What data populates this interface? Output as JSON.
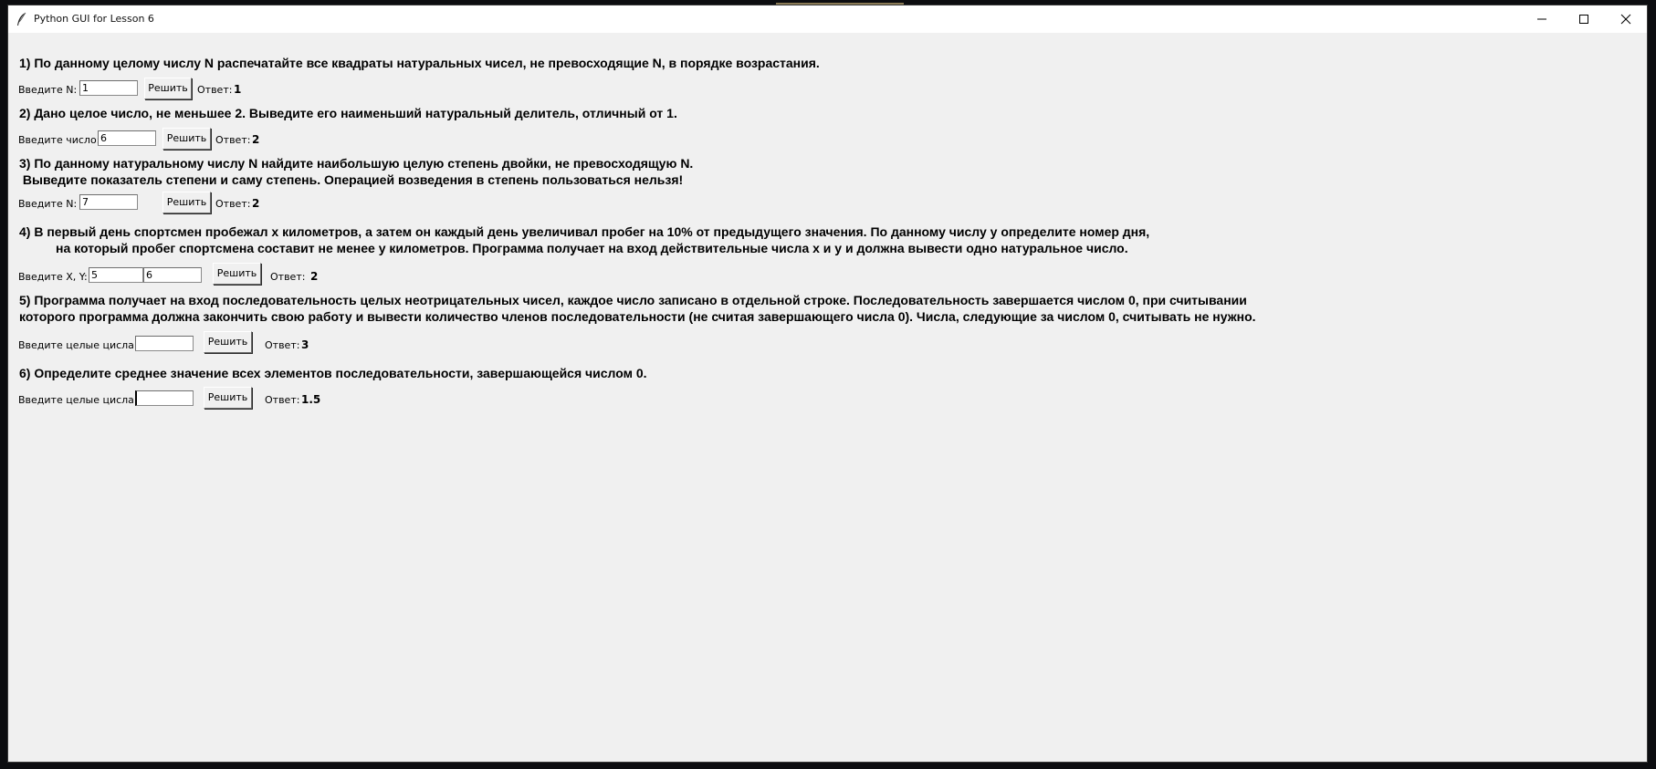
{
  "window": {
    "title": "Python GUI for Lesson 6",
    "minimize_icon": "minimize-icon",
    "maximize_icon": "maximize-icon",
    "close_icon": "close-icon",
    "app_icon": "tk-feather-icon"
  },
  "tasks": [
    {
      "heading_lines": [
        "1) По данному целому числу N распечатайте все квадраты натуральных чисел, не превосходящие N, в порядке возрастания."
      ],
      "input_label": "Введите N:",
      "inputs": [
        "1"
      ],
      "button": "Решить",
      "answer_label": "Ответ:",
      "answer": "1"
    },
    {
      "heading_lines": [
        "2) Дано целое число, не меньшее 2. Выведите его наименьший натуральный делитель, отличный от 1."
      ],
      "input_label": "Введите число:",
      "inputs": [
        "6"
      ],
      "button": "Решить",
      "answer_label": "Ответ:",
      "answer": "2"
    },
    {
      "heading_lines": [
        "3) По данному натуральному числу N найдите наибольшую целую степень двойки, не превосходящую N.",
        " Выведите показатель степени и саму степень. Операцией возведения в степень пользоваться нельзя!"
      ],
      "input_label": "Введите N:",
      "inputs": [
        "7"
      ],
      "button": "Решить",
      "answer_label": "Ответ:",
      "answer": "2"
    },
    {
      "heading_lines": [
        "4) В первый день спортсмен пробежал x километров, а затем он каждый день увеличивал пробег на 10% от предыдущего значения. По данному числу y определите номер дня,",
        "на который пробег спортсмена составит не менее y километров. Программа получает на вход действительные числа x и y и должна вывести одно натуральное число."
      ],
      "input_label": "Введите X, Y:",
      "inputs": [
        "5",
        "6"
      ],
      "button": "Решить",
      "answer_label": "Ответ:",
      "answer": "2"
    },
    {
      "heading_lines": [
        "5) Программа получает на вход последовательность целых неотрицательных чисел, каждое число записано в отдельной строке. Последовательность завершается числом 0, при считывании",
        "которого программа должна закончить свою работу и вывести количество членов последовательности (не считая завершающего числа 0). Числа, следующие за числом 0, считывать не нужно."
      ],
      "input_label": "Введите целые цисла:",
      "inputs": [
        ""
      ],
      "button": "Решить",
      "answer_label": "Ответ:",
      "answer": "3"
    },
    {
      "heading_lines": [
        "6) Определите среднее значение всех элементов последовательности, завершающейся числом 0."
      ],
      "input_label": "Введите целые цисла:",
      "inputs": [
        ""
      ],
      "button": "Решить",
      "answer_label": "Ответ:",
      "answer": "1.5"
    }
  ]
}
